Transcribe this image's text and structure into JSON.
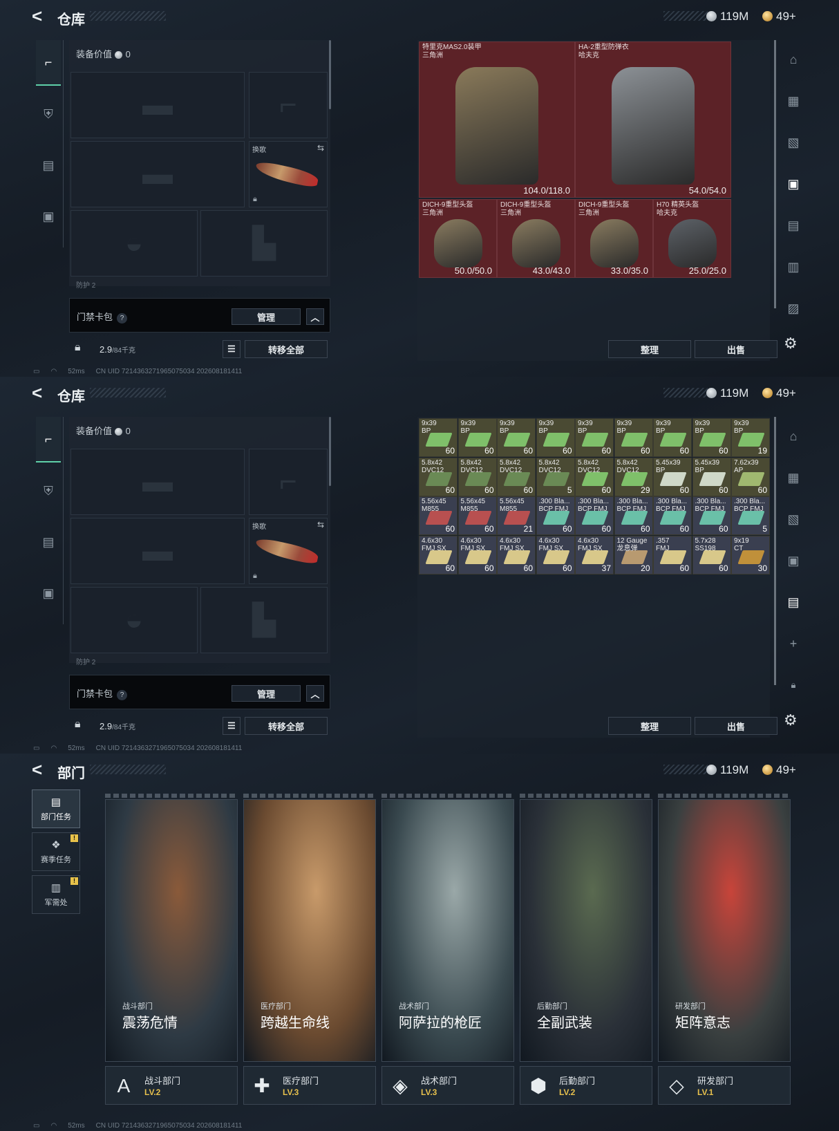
{
  "currency": {
    "silver": "119M",
    "gold": "49+"
  },
  "status": {
    "ping": "52ms",
    "uid": "CN UID 7214363271965075034 202608181411"
  },
  "warehouse": {
    "title": "仓库",
    "equip_value_label": "装备价值",
    "equip_value": "0",
    "swap_label": "换歌",
    "keycard_label": "门禁卡包",
    "qmark": "?",
    "manage_label": "管理",
    "weight_value": "2.9",
    "weight_max": "/84千克",
    "transfer_all_label": "转移全部",
    "sort_label": "整理",
    "sell_label": "出售",
    "partial_label": "防护 2"
  },
  "stash_armor": [
    {
      "name": "特里克MAS2.0装甲",
      "sub": "三角洲",
      "dur": "104.0/118.0",
      "type": "vest",
      "color": "#8a7a5a"
    },
    {
      "name": "HA-2重型防弹衣",
      "sub": "哈夫克",
      "dur": "54.0/54.0",
      "type": "vest",
      "color": "#8c9196"
    },
    {
      "name": "DICH-9重型头盔",
      "sub": "三角洲",
      "dur": "50.0/50.0",
      "type": "helm",
      "color": "#8a7c60"
    },
    {
      "name": "DICH-9重型头盔",
      "sub": "三角洲",
      "dur": "43.0/43.0",
      "type": "helm",
      "color": "#8a7c60"
    },
    {
      "name": "DICH-9重型头盔",
      "sub": "三角洲",
      "dur": "33.0/35.0",
      "type": "helm",
      "color": "#8a7c60"
    },
    {
      "name": "H70 精英头盔",
      "sub": "哈夫克",
      "dur": "25.0/25.0",
      "type": "helm",
      "color": "#5d6268"
    }
  ],
  "stash_ammo": [
    {
      "n1": "9x39",
      "n2": "BP",
      "c": "60",
      "bg": "#4a4a33",
      "box": "#7fc06a"
    },
    {
      "n1": "9x39",
      "n2": "BP",
      "c": "60",
      "bg": "#4a4a33",
      "box": "#7fc06a"
    },
    {
      "n1": "9x39",
      "n2": "BP",
      "c": "60",
      "bg": "#4a4a33",
      "box": "#7fc06a"
    },
    {
      "n1": "9x39",
      "n2": "BP",
      "c": "60",
      "bg": "#4a4a33",
      "box": "#7fc06a"
    },
    {
      "n1": "9x39",
      "n2": "BP",
      "c": "60",
      "bg": "#4a4a33",
      "box": "#7fc06a"
    },
    {
      "n1": "9x39",
      "n2": "BP",
      "c": "60",
      "bg": "#4a4a33",
      "box": "#7fc06a"
    },
    {
      "n1": "9x39",
      "n2": "BP",
      "c": "60",
      "bg": "#4a4a33",
      "box": "#7fc06a"
    },
    {
      "n1": "9x39",
      "n2": "BP",
      "c": "60",
      "bg": "#4a4a33",
      "box": "#7fc06a"
    },
    {
      "n1": "9x39",
      "n2": "BP",
      "c": "19",
      "bg": "#4a4a33",
      "box": "#7fc06a"
    },
    {
      "n1": "5.8x42",
      "n2": "DVC12",
      "c": "60",
      "bg": "#4a4a33",
      "box": "#6a8a55"
    },
    {
      "n1": "5.8x42",
      "n2": "DVC12",
      "c": "60",
      "bg": "#4a4a33",
      "box": "#6a8a55"
    },
    {
      "n1": "5.8x42",
      "n2": "DVC12",
      "c": "60",
      "bg": "#4a4a33",
      "box": "#6a8a55"
    },
    {
      "n1": "5.8x42",
      "n2": "DVC12",
      "c": "5",
      "bg": "#4a4a33",
      "box": "#6a8a55"
    },
    {
      "n1": "5.8x42",
      "n2": "DVC12",
      "c": "60",
      "bg": "#4a4a33",
      "box": "#7fc06a"
    },
    {
      "n1": "5.8x42",
      "n2": "DVC12",
      "c": "29",
      "bg": "#4a4a33",
      "box": "#7fc06a"
    },
    {
      "n1": "5.45x39",
      "n2": "BP",
      "c": "60",
      "bg": "#4a4a33",
      "box": "#cfd8c8"
    },
    {
      "n1": "5.45x39",
      "n2": "BP",
      "c": "60",
      "bg": "#4a4a33",
      "box": "#cfd8c8"
    },
    {
      "n1": "7.62x39",
      "n2": "AP",
      "c": "60",
      "bg": "#4a4a33",
      "box": "#a0b870"
    },
    {
      "n1": "5.56x45",
      "n2": "M855",
      "c": "60",
      "bg": "#3a3f50",
      "box": "#b85050"
    },
    {
      "n1": "5.56x45",
      "n2": "M855",
      "c": "60",
      "bg": "#3a3f50",
      "box": "#b85050"
    },
    {
      "n1": "5.56x45",
      "n2": "M855",
      "c": "21",
      "bg": "#3a3f50",
      "box": "#b85050"
    },
    {
      "n1": ".300 Bla...",
      "n2": "BCP FMJ",
      "c": "60",
      "bg": "#3a3f50",
      "box": "#6ac0a8"
    },
    {
      "n1": ".300 Bla...",
      "n2": "BCP FMJ",
      "c": "60",
      "bg": "#3a3f50",
      "box": "#6ac0a8"
    },
    {
      "n1": ".300 Bla...",
      "n2": "BCP FMJ",
      "c": "60",
      "bg": "#3a3f50",
      "box": "#6ac0a8"
    },
    {
      "n1": ".300 Bla...",
      "n2": "BCP FMJ",
      "c": "60",
      "bg": "#3a3f50",
      "box": "#6ac0a8"
    },
    {
      "n1": ".300 Bla...",
      "n2": "BCP FMJ",
      "c": "60",
      "bg": "#3a3f50",
      "box": "#6ac0a8"
    },
    {
      "n1": ".300 Bla...",
      "n2": "BCP FMJ",
      "c": "5",
      "bg": "#3a3f50",
      "box": "#6ac0a8"
    },
    {
      "n1": "4.6x30",
      "n2": "FMJ SX",
      "c": "60",
      "bg": "#3a3f50",
      "box": "#d8c88a"
    },
    {
      "n1": "4.6x30",
      "n2": "FMJ SX",
      "c": "60",
      "bg": "#3a3f50",
      "box": "#d8c88a"
    },
    {
      "n1": "4.6x30",
      "n2": "FMJ SX",
      "c": "60",
      "bg": "#3a3f50",
      "box": "#d8c88a"
    },
    {
      "n1": "4.6x30",
      "n2": "FMJ SX",
      "c": "60",
      "bg": "#3a3f50",
      "box": "#d8c88a"
    },
    {
      "n1": "4.6x30",
      "n2": "FMJ SX",
      "c": "37",
      "bg": "#3a3f50",
      "box": "#d8c88a"
    },
    {
      "n1": "12 Gauge",
      "n2": "龙息弹",
      "c": "20",
      "bg": "#3a3f50",
      "box": "#b89a70"
    },
    {
      "n1": ".357",
      "n2": "FMJ",
      "c": "60",
      "bg": "#3a3f50",
      "box": "#d8c88a"
    },
    {
      "n1": "5.7x28",
      "n2": "SS198",
      "c": "60",
      "bg": "#3a3f50",
      "box": "#d8c88a"
    },
    {
      "n1": "9x19",
      "n2": "CT",
      "c": "30",
      "bg": "#3a3f50",
      "box": "#c0903a"
    }
  ],
  "department": {
    "title": "部门",
    "tabs": [
      {
        "label": "部门任务",
        "icon": "▤",
        "badge": ""
      },
      {
        "label": "赛季任务",
        "icon": "❖",
        "badge": "!"
      },
      {
        "label": "军需处",
        "icon": "▥",
        "badge": "!"
      }
    ],
    "cards": [
      {
        "dept": "战斗部门",
        "task": "震荡危情",
        "level": "LV.2",
        "icon": "A",
        "c1": "#2e3a44",
        "c2": "#8a5a3a"
      },
      {
        "dept": "医疗部门",
        "task": "跨越生命线",
        "level": "LV.3",
        "icon": "✚",
        "c1": "#6a4a30",
        "c2": "#c89a6a"
      },
      {
        "dept": "战术部门",
        "task": "阿萨拉的枪匠",
        "level": "LV.3",
        "icon": "◈",
        "c1": "#3a4a50",
        "c2": "#9aa8a8"
      },
      {
        "dept": "后勤部门",
        "task": "全副武装",
        "level": "LV.2",
        "icon": "⬢",
        "c1": "#2a3038",
        "c2": "#5a6a50"
      },
      {
        "dept": "研发部门",
        "task": "矩阵意志",
        "level": "LV.1",
        "icon": "◇",
        "c1": "#3a4040",
        "c2": "#c8443a"
      }
    ]
  }
}
